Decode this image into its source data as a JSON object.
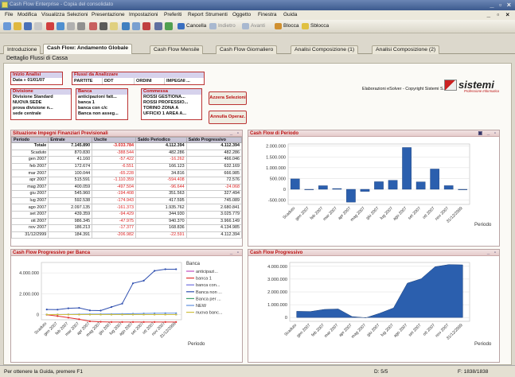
{
  "window": {
    "title": "Cash Flow Enterprise - Copia del consolidato",
    "controls": "_ ▫ ×"
  },
  "menu": [
    "File",
    "Modifica",
    "Visualizza",
    "Selezioni",
    "Presentazione",
    "Impostazioni",
    "Preferiti",
    "Report",
    "Strumenti",
    "Oggetto",
    "Finestra",
    "Guida"
  ],
  "mdi_controls": "_ ▫ ×",
  "toolbar": {
    "cancella": "Cancella",
    "indietro": "Indietro",
    "avanti": "Avanti",
    "blocca": "Blocca",
    "sblocca": "Sblocca"
  },
  "tabs": [
    "Introduzione",
    "Cash Flow: Andamento Globale",
    "Cash Flow Mensile",
    "Cash Flow Giornaliero",
    "Analisi Composizione (1)",
    "Analisi Composizione (2)"
  ],
  "active_tab": 1,
  "subtitle": "Dettaglio Flussi di Cassa",
  "filters": {
    "inizio_title": "Inizio Analisi",
    "inizio_value": "Data  » 01/01/07",
    "flussi_title": "Flussi da Analizzare",
    "flussi_cols": [
      "PARTITE",
      "DDT",
      "ORDINI",
      "IMPEGNI ..."
    ],
    "divisione_title": "Divisione",
    "divisione_items": [
      "Divisione Standard",
      "NUOVA SEDE",
      "prova divisione n...",
      "sede centrale"
    ],
    "banca_title": "Banca",
    "banca_items": [
      "anticipazioni fatt...",
      "banca 1",
      "banca con c/c",
      "Banca non asseg..."
    ],
    "commessa_title": "Commessa",
    "commessa_items": [
      "ROSSI GESTIONA...",
      "ROSSI PROFESSIO...",
      "TORINO ZONA A",
      "UFFICIO 1 AREA A..."
    ],
    "azzera": "Azzera Selezioni",
    "annulla": "Annulla Operaz."
  },
  "branding": {
    "copyright": "Elaborazioni eSolver - Copyright Sistemi S.p.A.",
    "logo": "sistemi",
    "tagline": "Professione Informatica"
  },
  "table_panel": {
    "title": "Situazione Impegni Finanziari Previsionali",
    "controls": "_ ▫",
    "headers": [
      "Periodo",
      "Entrate",
      "Uscite",
      "Saldo Periodico",
      "Saldo Progressivo"
    ],
    "rows": [
      [
        "Totale",
        "7.145.890",
        "-3.033.784",
        "4.112.394",
        "4.112.394"
      ],
      [
        "Scaduto",
        "870.830",
        "-388.544",
        "482.286",
        "482.286"
      ],
      [
        "gen 2007",
        "41.160",
        "-57.422",
        "-16.262",
        "466.046"
      ],
      [
        "feb 2007",
        "172.674",
        "-6.551",
        "166.123",
        "632.169"
      ],
      [
        "mar 2007",
        "100.044",
        "-65.228",
        "34.816",
        "666.985"
      ],
      [
        "apr 2007",
        "515.591",
        "-1.110.359",
        "-594.408",
        "72.576"
      ],
      [
        "mag 2007",
        "400.059",
        "-497.504",
        "-96.644",
        "-24.068"
      ],
      [
        "giu 2007",
        "545.960",
        "-194.408",
        "351.563",
        "327.494"
      ],
      [
        "lug 2007",
        "592.538",
        "-174.943",
        "417.595",
        "745.089"
      ],
      [
        "ago 2007",
        "2.097.135",
        "-161.373",
        "1.935.762",
        "2.680.841"
      ],
      [
        "set 2007",
        "439.359",
        "-94.429",
        "344.930",
        "3.025.779"
      ],
      [
        "ott 2007",
        "986.345",
        "-47.975",
        "940.370",
        "3.966.149"
      ],
      [
        "nov 2007",
        "186.213",
        "-17.377",
        "168.836",
        "4.134.985"
      ],
      [
        "31/12/2999",
        "184.391",
        "-206.982",
        "-22.591",
        "4.112.394"
      ]
    ],
    "negative_cols": [
      2
    ]
  },
  "chart_data": [
    {
      "type": "bar",
      "title": "Cash Flow di Periodo",
      "xlabel": "Periodo",
      "categories": [
        "Scaduto",
        "gen 2007",
        "feb 2007",
        "mar 2007",
        "apr 2007",
        "mag 2007",
        "giu 2007",
        "lug 2007",
        "ago 2007",
        "set 2007",
        "ott 2007",
        "nov 2007",
        "31/12/2999"
      ],
      "values": [
        482286,
        -16262,
        166123,
        34816,
        -594408,
        -96644,
        351563,
        417595,
        1935762,
        344930,
        940370,
        168836,
        -22591
      ],
      "yticks": [
        "2.000.000",
        "1.500.000",
        "1.000.000",
        "500.000",
        "0",
        "-500.000"
      ],
      "ylim": [
        -700000,
        2100000
      ],
      "color": "#2b5fae"
    },
    {
      "type": "line",
      "title": "Cash Flow Progressivo per Banca",
      "xlabel": "Periodo",
      "legend_title": "Banca",
      "categories": [
        "Scaduto",
        "gen 2007",
        "feb 2007",
        "mar 2007",
        "apr 2007",
        "mag 2007",
        "giu 2007",
        "lug 2007",
        "ago 2007",
        "set 2007",
        "ott 2007",
        "nov 2007",
        "31/12/2999"
      ],
      "yticks": [
        "4.000.000",
        "2.000.000",
        "0"
      ],
      "ylim": [
        -500000,
        5000000
      ],
      "series": [
        {
          "name": "anticipazi...",
          "color": "#c050c0",
          "values": [
            0,
            0,
            0,
            0,
            0,
            0,
            0,
            0,
            0,
            0,
            0,
            0,
            0
          ]
        },
        {
          "name": "banca 1",
          "color": "#e03030",
          "values": [
            -20000,
            -150000,
            -300000,
            -450000,
            -650000,
            -700000,
            -720000,
            -720000,
            -720000,
            -720000,
            -720000,
            -720000,
            -720000
          ]
        },
        {
          "name": "banca con...",
          "color": "#7070e0",
          "values": [
            0,
            0,
            0,
            0,
            0,
            0,
            0,
            0,
            0,
            0,
            0,
            0,
            0
          ]
        },
        {
          "name": "Banca non ...",
          "color": "#3050b0",
          "values": [
            482286,
            470000,
            600000,
            640000,
            400000,
            380000,
            720000,
            1050000,
            3000000,
            3250000,
            4200000,
            4350000,
            4350000
          ]
        },
        {
          "name": "Banca per ...",
          "color": "#40a070",
          "values": [
            0,
            0,
            0,
            0,
            0,
            0,
            0,
            0,
            0,
            0,
            0,
            0,
            0
          ]
        },
        {
          "name": "NEW",
          "color": "#6090e0",
          "values": [
            0,
            10000,
            20000,
            30000,
            40000,
            45000,
            50000,
            60000,
            80000,
            100000,
            120000,
            130000,
            130000
          ]
        },
        {
          "name": "nuova banc...",
          "color": "#d0c040",
          "values": [
            0,
            0,
            0,
            0,
            0,
            0,
            0,
            0,
            0,
            0,
            0,
            0,
            0
          ]
        }
      ]
    },
    {
      "type": "area",
      "title": "Cash Flow Progressivo",
      "xlabel": "Periodo",
      "categories": [
        "Scaduto",
        "gen 2007",
        "feb 2007",
        "mar 2007",
        "apr 2007",
        "mag 2007",
        "giu 2007",
        "lug 2007",
        "ago 2007",
        "set 2007",
        "ott 2007",
        "nov 2007",
        "31/12/2999"
      ],
      "values": [
        482286,
        466046,
        632169,
        666985,
        72576,
        -24068,
        327494,
        745089,
        2680841,
        3025779,
        3966149,
        4134985,
        4112394
      ],
      "yticks": [
        "4.000.000",
        "3.000.000",
        "2.000.000",
        "1.000.000",
        "0"
      ],
      "ylim": [
        -300000,
        4300000
      ],
      "color": "#2b5fae"
    }
  ],
  "status": {
    "help": "Per ottenere la Guida, premere F1",
    "doc": "D: 5/5",
    "record": "F: 1838/1838"
  }
}
